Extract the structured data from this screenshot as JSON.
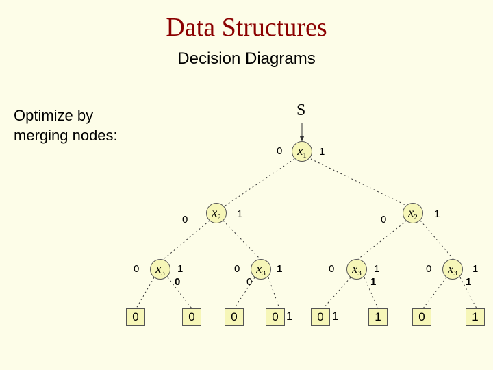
{
  "title": "Data Structures",
  "subtitle": "Decision Diagrams",
  "side_text_line1": "Optimize by",
  "side_text_line2": "merging nodes:",
  "root_label": "S",
  "vars": {
    "x1": {
      "name": "x",
      "sub": "1"
    },
    "x2": {
      "name": "x",
      "sub": "2"
    },
    "x3": {
      "name": "x",
      "sub": "3"
    }
  },
  "edge_labels": {
    "zero": "0",
    "one": "1"
  },
  "leaves": {
    "t0": "0",
    "t1": "0",
    "t2": "0",
    "t3": "0",
    "t3b": "1",
    "t4": "0",
    "t4b": "1",
    "t5": "1",
    "t6": "0",
    "t7": "1"
  },
  "extra_overlaps": {
    "x3a_under": "0",
    "x3b_under": "0",
    "x3c_label": "1",
    "x3c_under": "1",
    "x3d_under": "1"
  }
}
